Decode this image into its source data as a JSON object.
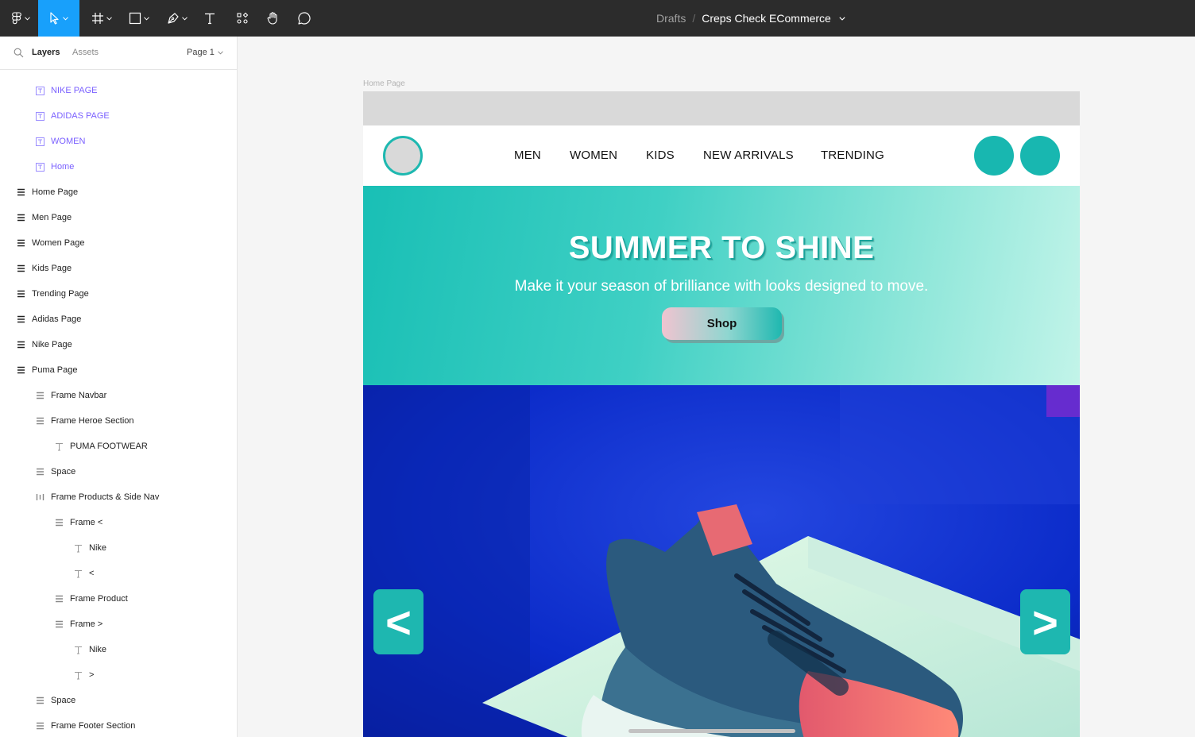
{
  "toolbar": {
    "tools": [
      "figma-menu",
      "move",
      "frame",
      "shape",
      "pen",
      "text",
      "resources",
      "hand",
      "comment"
    ],
    "breadcrumb": {
      "drafts": "Drafts",
      "separator": "/",
      "file_name": "Creps Check ECommerce"
    }
  },
  "left_panel": {
    "tabs": {
      "layers": "Layers",
      "assets": "Assets"
    },
    "page_selector": "Page 1",
    "layers": [
      {
        "label": "NIKE PAGE",
        "icon": "component-text-icon",
        "indent": 1,
        "style": "purple"
      },
      {
        "label": "ADIDAS PAGE",
        "icon": "component-text-icon",
        "indent": 1,
        "style": "purple"
      },
      {
        "label": "WOMEN",
        "icon": "component-text-icon",
        "indent": 1,
        "style": "purple"
      },
      {
        "label": "Home",
        "icon": "component-text-icon",
        "indent": 1,
        "style": "purple"
      },
      {
        "label": "Home Page",
        "icon": "frame-rows-icon",
        "indent": 0,
        "style": "bold"
      },
      {
        "label": "Men Page",
        "icon": "frame-rows-icon",
        "indent": 0,
        "style": "bold"
      },
      {
        "label": "Women Page",
        "icon": "frame-rows-icon",
        "indent": 0,
        "style": "bold"
      },
      {
        "label": "Kids Page",
        "icon": "frame-rows-icon",
        "indent": 0,
        "style": "bold"
      },
      {
        "label": "Trending Page",
        "icon": "frame-rows-icon",
        "indent": 0,
        "style": "bold"
      },
      {
        "label": "Adidas Page",
        "icon": "frame-rows-icon",
        "indent": 0,
        "style": "bold"
      },
      {
        "label": "Nike Page",
        "icon": "frame-rows-icon",
        "indent": 0,
        "style": "bold"
      },
      {
        "label": "Puma Page",
        "icon": "frame-rows-icon",
        "indent": 0,
        "style": "bold"
      },
      {
        "label": "Frame Navbar",
        "icon": "frame-rows-icon",
        "indent": 1,
        "style": "normal"
      },
      {
        "label": "Frame Heroe Section",
        "icon": "frame-rows-icon",
        "indent": 1,
        "style": "normal"
      },
      {
        "label": "PUMA FOOTWEAR",
        "icon": "text-icon",
        "indent": 2,
        "style": "normal"
      },
      {
        "label": "Space",
        "icon": "frame-rows-icon",
        "indent": 1,
        "style": "normal"
      },
      {
        "label": "Frame Products & Side Nav",
        "icon": "frame-columns-icon",
        "indent": 1,
        "style": "normal"
      },
      {
        "label": "Frame <",
        "icon": "frame-rows-icon",
        "indent": 2,
        "style": "normal"
      },
      {
        "label": "Nike",
        "icon": "text-icon",
        "indent": 3,
        "style": "normal"
      },
      {
        "label": "<",
        "icon": "text-icon",
        "indent": 3,
        "style": "normal"
      },
      {
        "label": "Frame Product",
        "icon": "frame-rows-icon",
        "indent": 2,
        "style": "normal"
      },
      {
        "label": "Frame >",
        "icon": "frame-rows-icon",
        "indent": 2,
        "style": "normal"
      },
      {
        "label": "Nike",
        "icon": "text-icon",
        "indent": 3,
        "style": "normal"
      },
      {
        "label": ">",
        "icon": "text-icon",
        "indent": 3,
        "style": "normal"
      },
      {
        "label": "Space",
        "icon": "frame-rows-icon",
        "indent": 1,
        "style": "normal"
      },
      {
        "label": "Frame Footer Section",
        "icon": "frame-rows-icon",
        "indent": 1,
        "style": "normal"
      }
    ]
  },
  "canvas": {
    "frame_label": "Home Page",
    "nav_links": [
      "MEN",
      "WOMEN",
      "KIDS",
      "NEW ARRIVALS",
      "TRENDING"
    ],
    "hero": {
      "title": "SUMMER TO SHINE",
      "subtitle": "Make it your season of brilliance with looks designed to move.",
      "button": "Shop"
    },
    "carousel": {
      "prev": "<",
      "next": ">"
    },
    "product_image": "blue-adidas-sneaker-photo"
  },
  "colors": {
    "toolbar_bg": "#2c2c2c",
    "active_tool": "#18a0fb",
    "accent_teal": "#18b7b0",
    "component_purple": "#7b61ff",
    "product_bg_blue": "#0f2fd1"
  }
}
